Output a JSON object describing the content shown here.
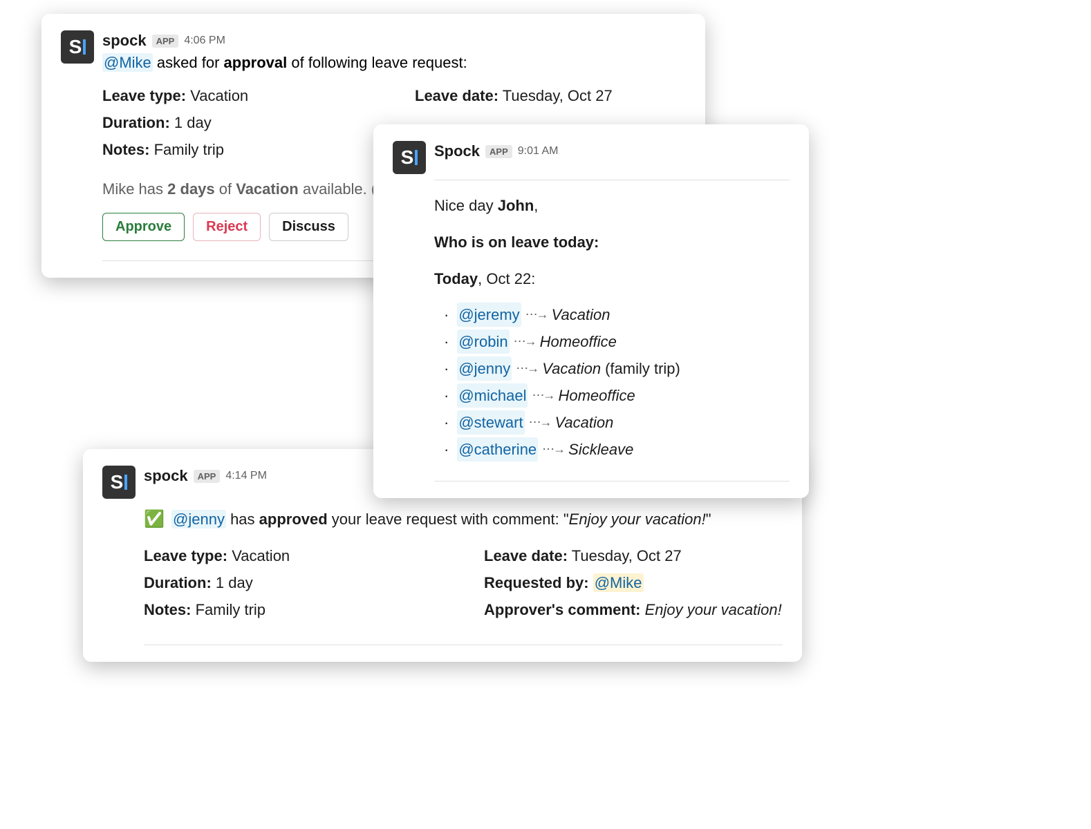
{
  "card1": {
    "sender": "spock",
    "badge": "APP",
    "time": "4:06 PM",
    "mention": "@Mike",
    "line_mid": " asked for ",
    "line_bold": "approval",
    "line_end": " of following leave request:",
    "leave_type_label": "Leave type:",
    "leave_type": "Vacation",
    "leave_date_label": "Leave date:",
    "leave_date": "Tuesday, Oct 27",
    "duration_label": "Duration:",
    "duration": "1 day",
    "notes_label": "Notes:",
    "notes": "Family trip",
    "helper_pre": "Mike has ",
    "helper_days": "2 days",
    "helper_mid": " of ",
    "helper_type": "Vacation",
    "helper_post": " available. (Ye",
    "btn_approve": "Approve",
    "btn_reject": "Reject",
    "btn_discuss": "Discuss"
  },
  "card2": {
    "sender": "Spock",
    "badge": "APP",
    "time": "9:01 AM",
    "greet_pre": "Nice day ",
    "greet_name": "John",
    "greet_post": ",",
    "subhead": "Who is on leave today:",
    "today_bold": "Today",
    "today_rest": ", Oct 22:",
    "items": [
      {
        "mention": "@jeremy",
        "type": "Vacation",
        "extra": ""
      },
      {
        "mention": "@robin",
        "type": "Homeoffice",
        "extra": ""
      },
      {
        "mention": "@jenny",
        "type": "Vacation",
        "extra": " (family trip)"
      },
      {
        "mention": "@michael",
        "type": "Homeoffice",
        "extra": ""
      },
      {
        "mention": "@stewart",
        "type": "Vacation",
        "extra": ""
      },
      {
        "mention": "@catherine",
        "type": "Sickleave",
        "extra": ""
      }
    ]
  },
  "card3": {
    "sender": "spock",
    "badge": "APP",
    "time": "4:14 PM",
    "check": "✅",
    "mention": "@jenny",
    "line_mid1": " has ",
    "line_bold": "approved",
    "line_mid2": " your leave request with comment: \"",
    "line_comment": "Enjoy your vacation!",
    "line_end": "\"",
    "leave_type_label": "Leave type:",
    "leave_type": "Vacation",
    "leave_date_label": "Leave date:",
    "leave_date": "Tuesday, Oct 27",
    "duration_label": "Duration:",
    "duration": "1 day",
    "requested_label": "Requested by:",
    "requested_mention": "@Mike",
    "notes_label": "Notes:",
    "notes": "Family trip",
    "approver_label": "Approver's comment:",
    "approver_comment": "Enjoy your vacation!"
  }
}
